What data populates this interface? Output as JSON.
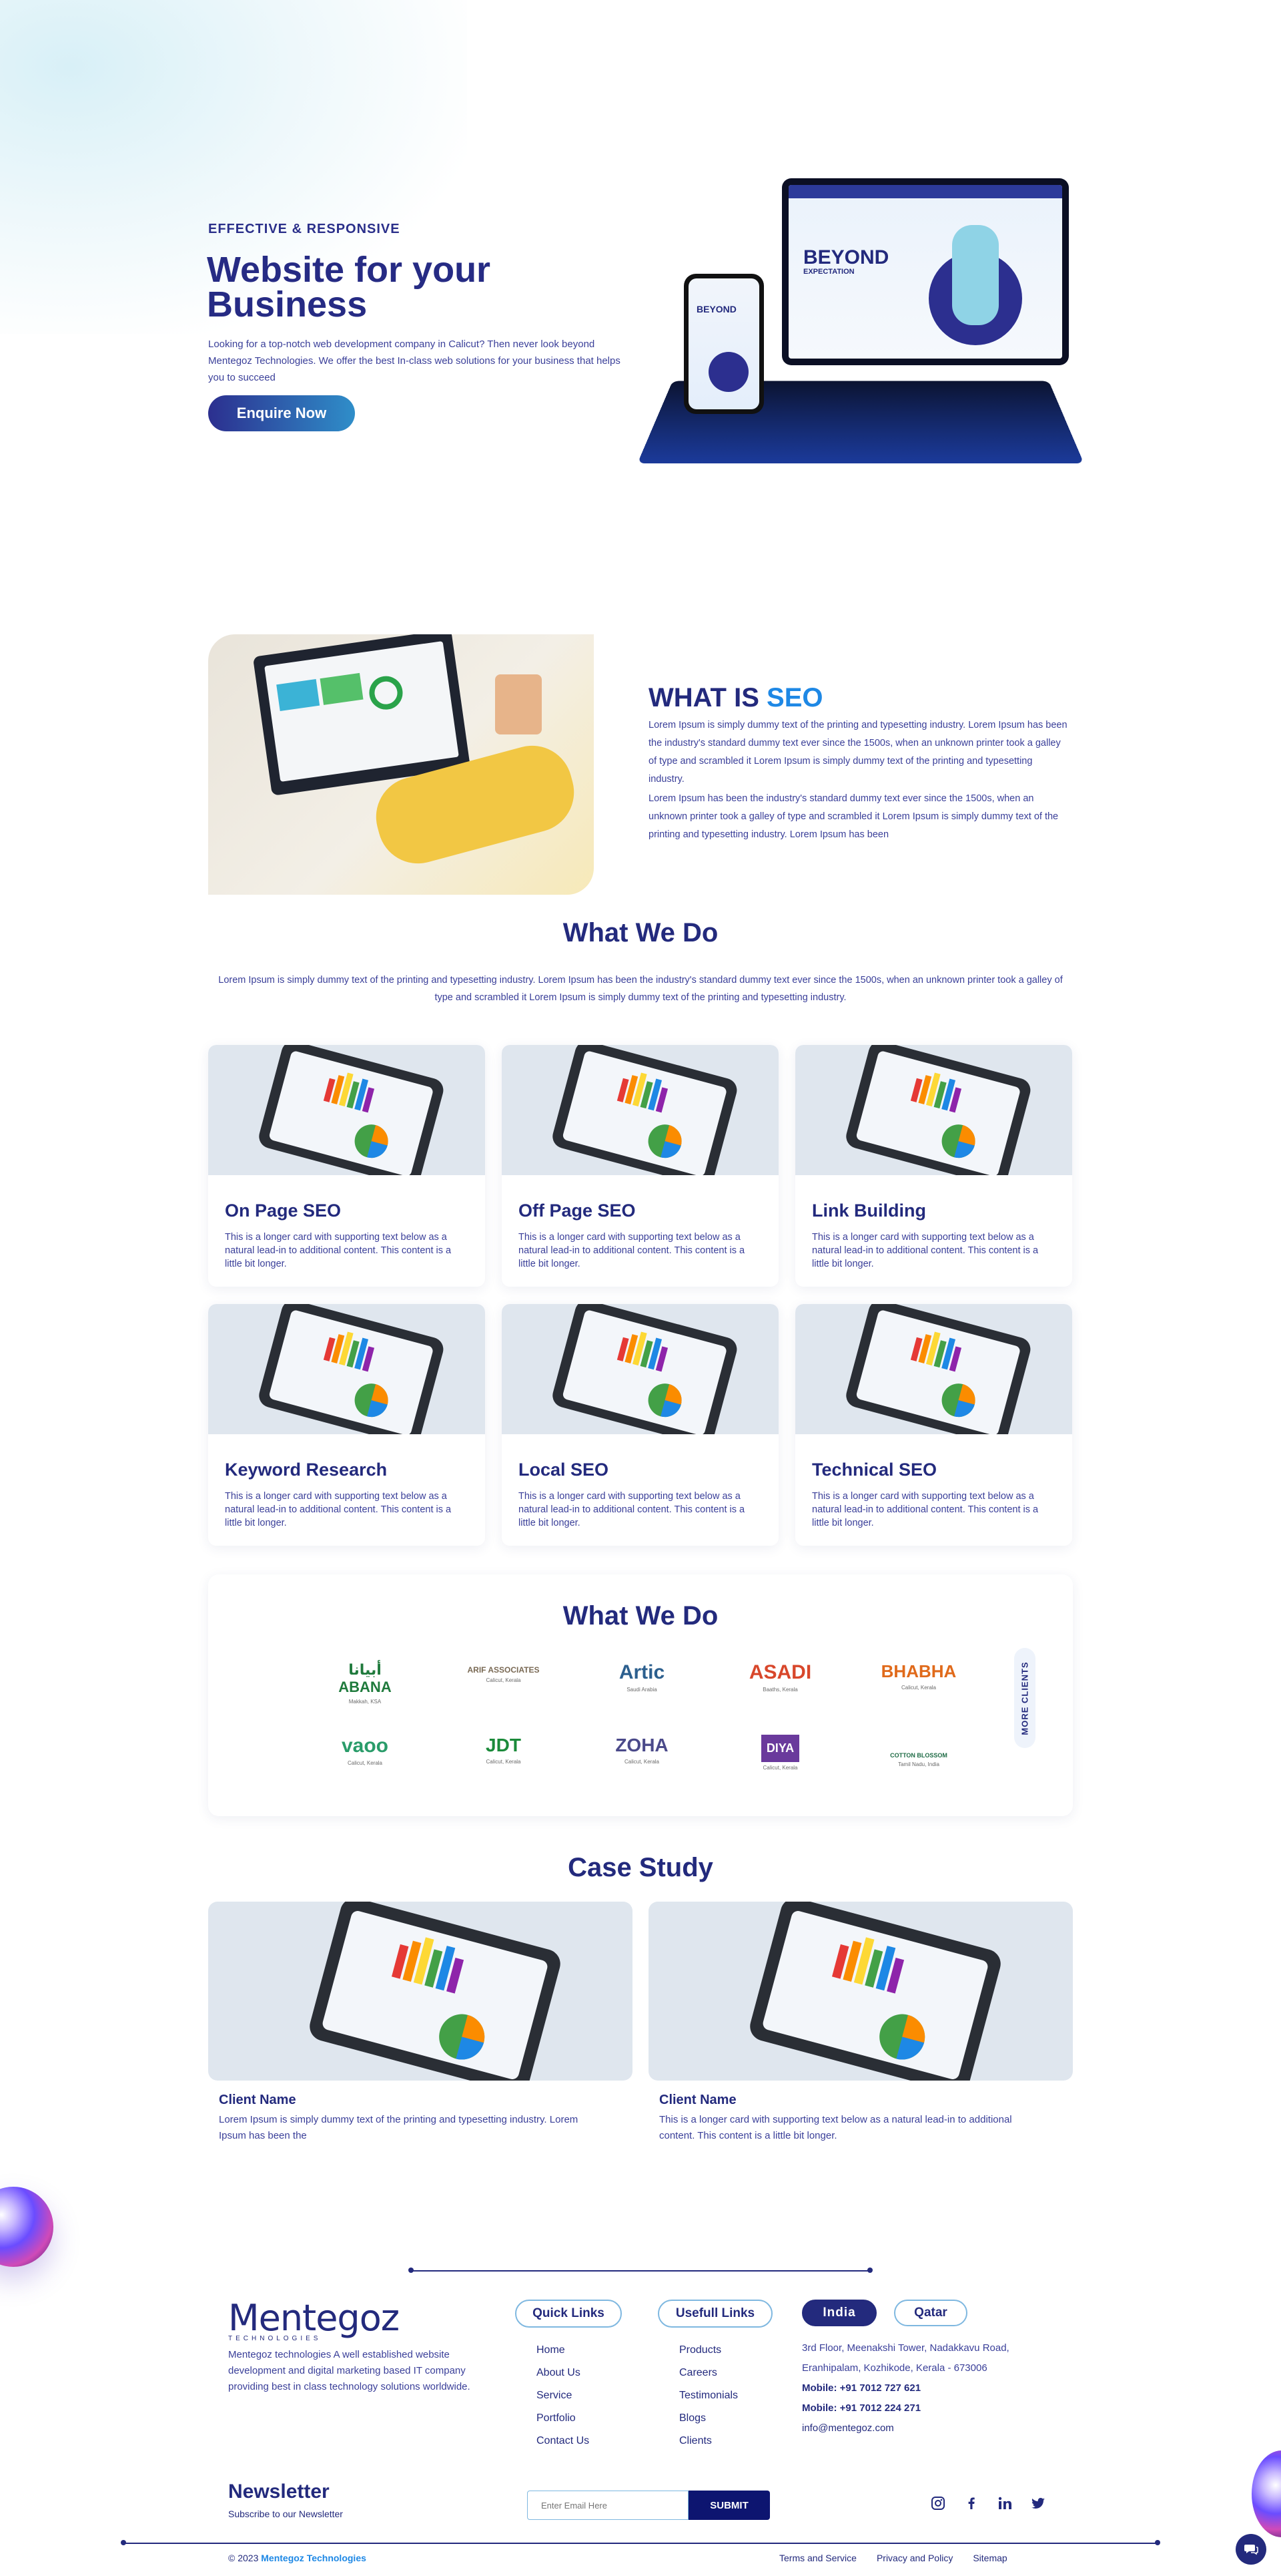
{
  "hero": {
    "eyebrow": "EFFECTIVE & RESPONSIVE",
    "title_line1": "Website for your",
    "title_line2": "Business",
    "description": "Looking for a top-notch web development company in Calicut? Then never look beyond Mentegoz Technologies. We offer the best In-class web solutions for your business that helps you to succeed",
    "cta": "Enquire Now",
    "mock_laptop_title": "BEYOND",
    "mock_laptop_subtitle": "EXPECTATION",
    "mock_phone_title": "BEYOND"
  },
  "seo": {
    "title_part1": "WHAT IS",
    "title_part2": "SEO",
    "para1": "Lorem Ipsum is simply dummy text of the printing and typesetting industry. Lorem Ipsum has been the industry's standard dummy text ever since the 1500s, when an unknown printer took a galley of type and scrambled it Lorem Ipsum is simply dummy text of the printing and typesetting industry.",
    "para2": "Lorem Ipsum has been the industry's standard dummy text ever since the 1500s, when an unknown printer took a galley of type and scrambled it Lorem Ipsum is simply dummy text of the printing and typesetting industry. Lorem Ipsum has been"
  },
  "services": {
    "title": "What We Do",
    "intro": "Lorem Ipsum is simply dummy text of the printing and typesetting industry. Lorem Ipsum has been the industry's standard dummy text ever since the 1500s, when an unknown printer took a galley of type and scrambled it Lorem Ipsum is simply dummy text of the printing and typesetting industry.",
    "cards": [
      {
        "title": "On Page SEO",
        "text": "This is a longer card with supporting text below as a natural lead-in to additional content. This content is a little bit longer."
      },
      {
        "title": "Off Page SEO",
        "text": "This is a longer card with supporting text below as a natural lead-in to additional content. This content is a little bit longer."
      },
      {
        "title": "Link Building",
        "text": "This is a longer card with supporting text below as a natural lead-in to additional content. This content is a little bit longer."
      },
      {
        "title": "Keyword Research",
        "text": "This is a longer card with supporting text below as a natural lead-in to additional content. This content is a little bit longer."
      },
      {
        "title": "Local SEO",
        "text": "This is a longer card with supporting text below as a natural lead-in to additional content. This content is a little bit longer."
      },
      {
        "title": "Technical SEO",
        "text": "This is a longer card with supporting text below as a natural lead-in to additional content. This content is a little bit longer."
      }
    ]
  },
  "clients": {
    "title": "What We Do",
    "more_label": "MORE CLIENTS",
    "logos": [
      {
        "name": "أبيانا ABANA",
        "sub": "Makkah, KSA",
        "color": "#1f7a3c"
      },
      {
        "name": "ARIF ASSOCIATES",
        "sub": "Calicut, Kerala",
        "color": "#7a6a55"
      },
      {
        "name": "Artic",
        "sub": "Saudi Arabia",
        "color": "#2c5f8e"
      },
      {
        "name": "ASADI",
        "sub": "Baaths, Kerala",
        "color": "#d8472b"
      },
      {
        "name": "BHABHA",
        "sub": "Calicut, Kerala",
        "color": "#e06a1b"
      },
      {
        "name": "vaoo",
        "sub": "Calicut, Kerala",
        "color": "#2a9c6a"
      },
      {
        "name": "JDT",
        "sub": "Calicut, Kerala",
        "color": "#1b8a3a"
      },
      {
        "name": "ZOHA",
        "sub": "Calicut, Kerala",
        "color": "#4b4a8a"
      },
      {
        "name": "DIYA",
        "sub": "Calicut, Kerala",
        "color": "#6a3a9c"
      },
      {
        "name": "COTTON BLOSSOM",
        "sub": "Tamil Nadu, India",
        "color": "#1e6b45"
      }
    ]
  },
  "case_study": {
    "title": "Case Study",
    "items": [
      {
        "name": "Client Name",
        "text": "Lorem Ipsum is simply dummy text of the printing and typesetting industry. Lorem Ipsum has been the"
      },
      {
        "name": "Client Name",
        "text": "This is a longer card with supporting text below as a natural lead-in to additional content. This content is a little bit longer."
      }
    ]
  },
  "footer": {
    "brand": "Mentegoz",
    "brand_sub": "TECHNOLOGIES",
    "about": "Mentegoz technologies A well established website development and digital marketing based IT company providing best in class technology solutions worldwide.",
    "quick_links_title": "Quick Links",
    "quick_links": [
      "Home",
      "About Us",
      "Service",
      "Portfolio",
      "Contact Us"
    ],
    "useful_links_title": "Usefull Links",
    "useful_links": [
      "Products",
      "Careers",
      "Testimonials",
      "Blogs",
      "Clients"
    ],
    "tab_india": "India",
    "tab_qatar": "Qatar",
    "address": "3rd Floor, Meenakshi Tower, Nadakkavu Road, Eranhipalam, Kozhikode, Kerala - 673006",
    "mobile1": "Mobile: +91 7012 727 621",
    "mobile2": "Mobile: +91 7012 224 271",
    "email": "info@mentegoz.com",
    "newsletter_title": "Newsletter",
    "newsletter_sub": "Subscribe to our Newsletter",
    "email_placeholder": "Enter Email Here",
    "submit": "SUBMIT",
    "copyright_prefix": "© 2023",
    "copyright_brand": "Mentegoz Technologies",
    "legal": [
      "Terms and Service",
      "Privacy and Policy",
      "Sitemap"
    ]
  },
  "colors": {
    "navy": "#232a7d",
    "accent_blue": "#1e88e5",
    "cta_gradient_end": "#2f8ec9"
  }
}
